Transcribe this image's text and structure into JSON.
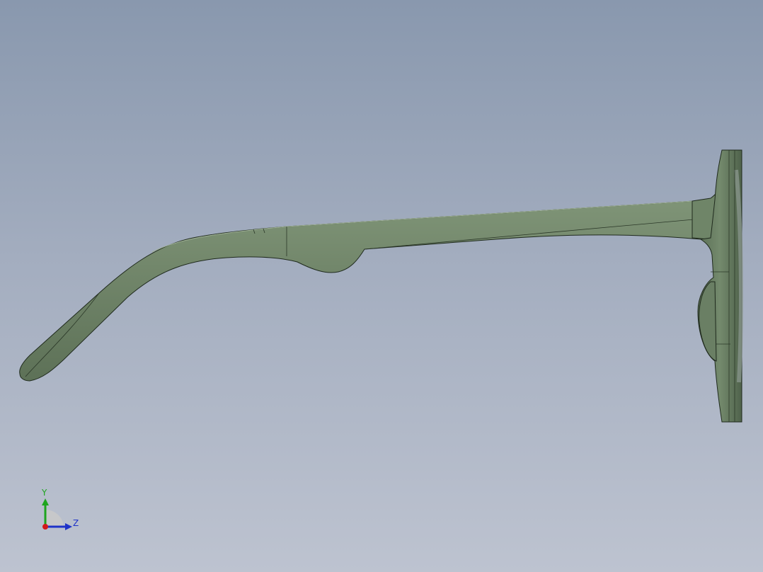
{
  "viewport": {
    "view": "side-view",
    "background_top": "#8998ae",
    "background_bottom": "#bdc3d0"
  },
  "model": {
    "part": "sunglasses",
    "color": "#6a7f64",
    "edge_color": "#1f2a1d"
  },
  "triad": {
    "y_label": "Y",
    "z_label": "Z",
    "y_color": "#1ea51e",
    "z_color": "#1f33c8",
    "x_color": "#d21a1a"
  }
}
